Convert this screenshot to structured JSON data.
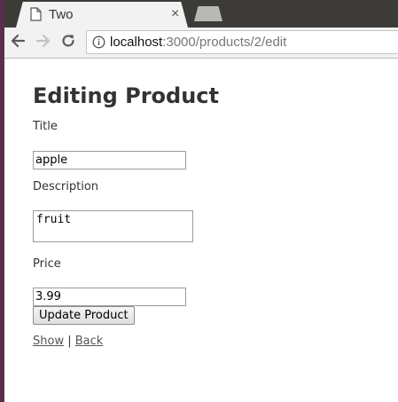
{
  "browser": {
    "tab_title": "Two",
    "tab_close": "×",
    "url_host": "localhost",
    "url_path": ":3000/products/2/edit"
  },
  "page": {
    "heading": "Editing Product",
    "title_label": "Title",
    "title_value": "apple",
    "description_label": "Description",
    "description_value": "fruit",
    "price_label": "Price",
    "price_value": "3.99",
    "submit_label": "Update Product",
    "show_link": "Show",
    "separator": "|",
    "back_link": "Back"
  },
  "colors": {
    "tabstrip": "#3c3b37",
    "toolbar": "#f2f2f2",
    "link": "#555555"
  }
}
